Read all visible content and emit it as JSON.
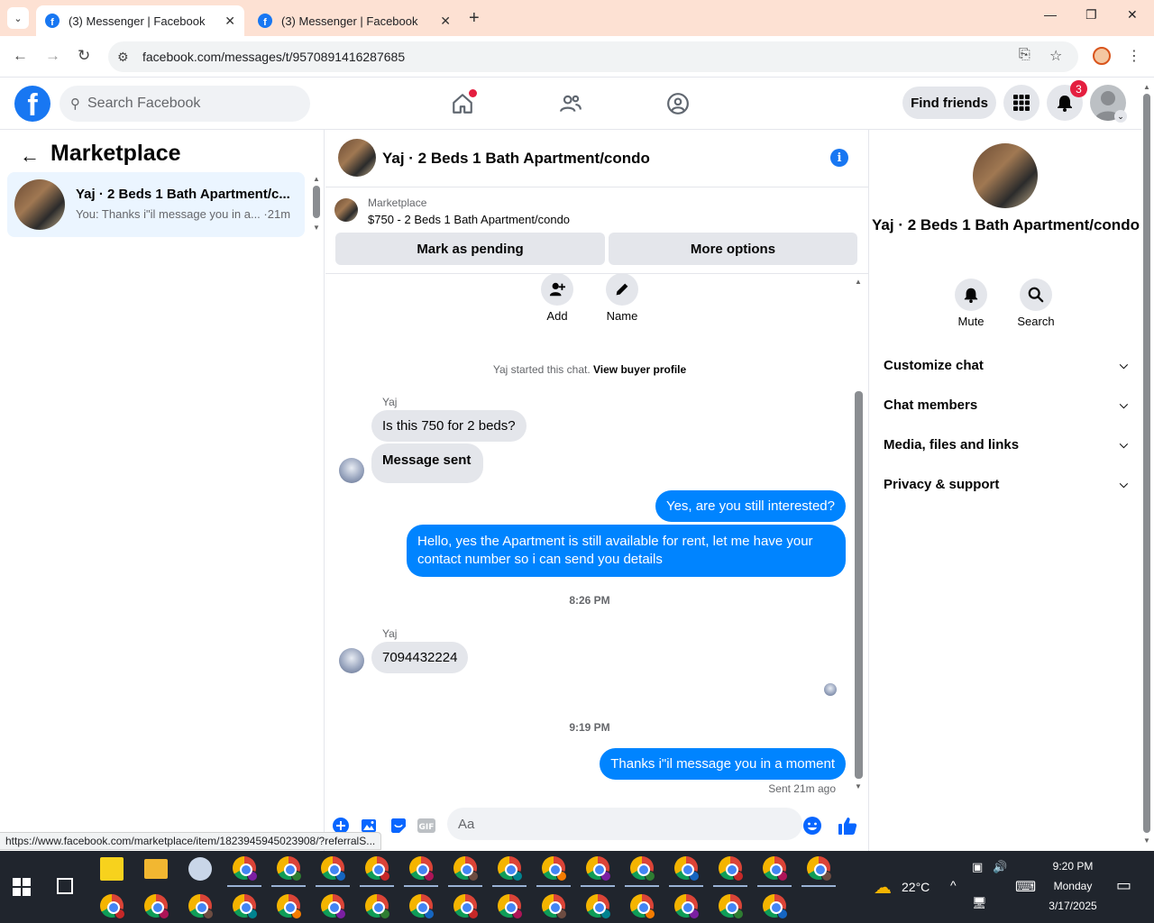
{
  "browser": {
    "tabs": [
      {
        "title": "(3) Messenger | Facebook",
        "active": true
      },
      {
        "title": "(3) Messenger | Facebook",
        "active": false
      }
    ],
    "url": "facebook.com/messages/t/9570891416287685",
    "status_url": "https://www.facebook.com/marketplace/item/1823945945023908/?referralS..."
  },
  "header": {
    "search_placeholder": "Search Facebook",
    "find_friends": "Find friends",
    "notification_count": "3"
  },
  "left": {
    "title": "Marketplace",
    "conversations": [
      {
        "name": "Yaj · 2 Beds 1 Bath Apartment/c...",
        "snippet": "You: Thanks i\"il message you in a... ·21m"
      }
    ]
  },
  "chat": {
    "title": "Yaj · 2 Beds 1 Bath Apartment/condo",
    "listing": {
      "label": "Marketplace",
      "price_title": "$750 - 2 Beds 1 Bath Apartment/condo"
    },
    "buttons": {
      "pending": "Mark as pending",
      "more": "More options"
    },
    "actions": {
      "add": "Add",
      "name": "Name"
    },
    "system": {
      "started": "Yaj started this chat.",
      "view_profile": "View buyer profile"
    },
    "messages": {
      "sender": "Yaj",
      "m1": "Is this 750 for 2 beds?",
      "m2": "Message sent",
      "m3": "Yes, are you still interested?",
      "m4": "Hello, yes the Apartment is still available for rent, let me have your contact number so i can send you details",
      "time1": "8:26 PM",
      "m5": "7094432224",
      "time2": "9:19 PM",
      "m6": "Thanks i\"il message you in a moment",
      "status": "Sent 21m ago"
    },
    "composer_placeholder": "Aa"
  },
  "right": {
    "name": "Yaj · 2 Beds 1 Bath Apartment/condo",
    "mute": "Mute",
    "search": "Search",
    "sections": [
      "Customize chat",
      "Chat members",
      "Media, files and links",
      "Privacy & support"
    ]
  },
  "taskbar": {
    "temperature": "22°C",
    "time": "9:20 PM",
    "day": "Monday",
    "date": "3/17/2025"
  },
  "colors": {
    "brand": "#1877f2",
    "outgoing": "#0084ff",
    "badge": "#e41e3f"
  }
}
